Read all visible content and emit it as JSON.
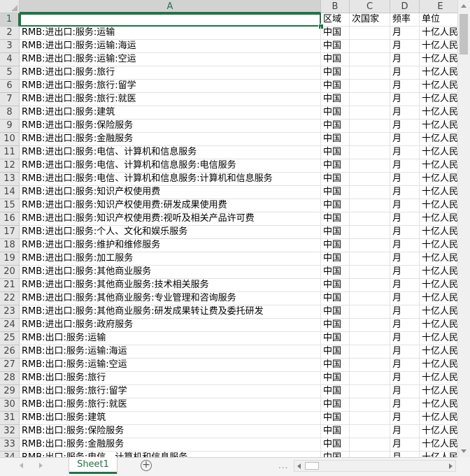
{
  "columns": [
    "A",
    "B",
    "C",
    "D",
    "E"
  ],
  "headers": {
    "a": "",
    "b": "区域",
    "c": "次国家",
    "d": "频率",
    "e": "单位"
  },
  "rows": [
    {
      "n": "2",
      "a": "RMB:进出口:服务:运输",
      "b": "中国",
      "c": "",
      "d": "月",
      "e": "十亿人民币"
    },
    {
      "n": "3",
      "a": "RMB:进出口:服务:运输:海运",
      "b": "中国",
      "c": "",
      "d": "月",
      "e": "十亿人民币"
    },
    {
      "n": "4",
      "a": "RMB:进出口:服务:运输:空运",
      "b": "中国",
      "c": "",
      "d": "月",
      "e": "十亿人民币"
    },
    {
      "n": "5",
      "a": "RMB:进出口:服务:旅行",
      "b": "中国",
      "c": "",
      "d": "月",
      "e": "十亿人民币"
    },
    {
      "n": "6",
      "a": "RMB:进出口:服务:旅行:留学",
      "b": "中国",
      "c": "",
      "d": "月",
      "e": "十亿人民币"
    },
    {
      "n": "7",
      "a": "RMB:进出口:服务:旅行:就医",
      "b": "中国",
      "c": "",
      "d": "月",
      "e": "十亿人民币"
    },
    {
      "n": "8",
      "a": "RMB:进出口:服务:建筑",
      "b": "中国",
      "c": "",
      "d": "月",
      "e": "十亿人民币"
    },
    {
      "n": "9",
      "a": "RMB:进出口:服务:保险服务",
      "b": "中国",
      "c": "",
      "d": "月",
      "e": "十亿人民币"
    },
    {
      "n": "10",
      "a": "RMB:进出口:服务:金融服务",
      "b": "中国",
      "c": "",
      "d": "月",
      "e": "十亿人民币"
    },
    {
      "n": "11",
      "a": "RMB:进出口:服务:电信、计算机和信息服务",
      "b": "中国",
      "c": "",
      "d": "月",
      "e": "十亿人民币"
    },
    {
      "n": "12",
      "a": "RMB:进出口:服务:电信、计算机和信息服务:电信服务",
      "b": "中国",
      "c": "",
      "d": "月",
      "e": "十亿人民币"
    },
    {
      "n": "13",
      "a": "RMB:进出口:服务:电信、计算机和信息服务:计算机和信息服务",
      "b": "中国",
      "c": "",
      "d": "月",
      "e": "十亿人民币"
    },
    {
      "n": "14",
      "a": "RMB:进出口:服务:知识产权使用费",
      "b": "中国",
      "c": "",
      "d": "月",
      "e": "十亿人民币"
    },
    {
      "n": "15",
      "a": "RMB:进出口:服务:知识产权使用费:研发成果使用费",
      "b": "中国",
      "c": "",
      "d": "月",
      "e": "十亿人民币"
    },
    {
      "n": "16",
      "a": "RMB:进出口:服务:知识产权使用费:视听及相关产品许可费",
      "b": "中国",
      "c": "",
      "d": "月",
      "e": "十亿人民币"
    },
    {
      "n": "17",
      "a": "RMB:进出口:服务:个人、文化和娱乐服务",
      "b": "中国",
      "c": "",
      "d": "月",
      "e": "十亿人民币"
    },
    {
      "n": "18",
      "a": "RMB:进出口:服务:维护和维修服务",
      "b": "中国",
      "c": "",
      "d": "月",
      "e": "十亿人民币"
    },
    {
      "n": "19",
      "a": "RMB:进出口:服务:加工服务",
      "b": "中国",
      "c": "",
      "d": "月",
      "e": "十亿人民币"
    },
    {
      "n": "20",
      "a": "RMB:进出口:服务:其他商业服务",
      "b": "中国",
      "c": "",
      "d": "月",
      "e": "十亿人民币"
    },
    {
      "n": "21",
      "a": "RMB:进出口:服务:其他商业服务:技术相关服务",
      "b": "中国",
      "c": "",
      "d": "月",
      "e": "十亿人民币"
    },
    {
      "n": "22",
      "a": "RMB:进出口:服务:其他商业服务:专业管理和咨询服务",
      "b": "中国",
      "c": "",
      "d": "月",
      "e": "十亿人民币"
    },
    {
      "n": "23",
      "a": "RMB:进出口:服务:其他商业服务:研发成果转让费及委托研发",
      "b": "中国",
      "c": "",
      "d": "月",
      "e": "十亿人民币"
    },
    {
      "n": "24",
      "a": "RMB:进出口:服务:政府服务",
      "b": "中国",
      "c": "",
      "d": "月",
      "e": "十亿人民币"
    },
    {
      "n": "25",
      "a": "RMB:出口:服务:运输",
      "b": "中国",
      "c": "",
      "d": "月",
      "e": "十亿人民币"
    },
    {
      "n": "26",
      "a": "RMB:出口:服务:运输:海运",
      "b": "中国",
      "c": "",
      "d": "月",
      "e": "十亿人民币"
    },
    {
      "n": "27",
      "a": "RMB:出口:服务:运输:空运",
      "b": "中国",
      "c": "",
      "d": "月",
      "e": "十亿人民币"
    },
    {
      "n": "28",
      "a": "RMB:出口:服务:旅行",
      "b": "中国",
      "c": "",
      "d": "月",
      "e": "十亿人民币"
    },
    {
      "n": "29",
      "a": "RMB:出口:服务:旅行:留学",
      "b": "中国",
      "c": "",
      "d": "月",
      "e": "十亿人民币"
    },
    {
      "n": "30",
      "a": "RMB:出口:服务:旅行:就医",
      "b": "中国",
      "c": "",
      "d": "月",
      "e": "十亿人民币"
    },
    {
      "n": "31",
      "a": "RMB:出口:服务:建筑",
      "b": "中国",
      "c": "",
      "d": "月",
      "e": "十亿人民币"
    },
    {
      "n": "32",
      "a": "RMB:出口:服务:保险服务",
      "b": "中国",
      "c": "",
      "d": "月",
      "e": "十亿人民币"
    },
    {
      "n": "33",
      "a": "RMB:出口:服务:金融服务",
      "b": "中国",
      "c": "",
      "d": "月",
      "e": "十亿人民币"
    },
    {
      "n": "34",
      "a": "RMB:出口:服务:电信、计算机和信息服务",
      "b": "中国",
      "c": "",
      "d": "月",
      "e": "十亿人民币"
    }
  ],
  "sheet_tab": "Sheet1",
  "add_sheet_symbol": "+",
  "tab_overflow": "..."
}
